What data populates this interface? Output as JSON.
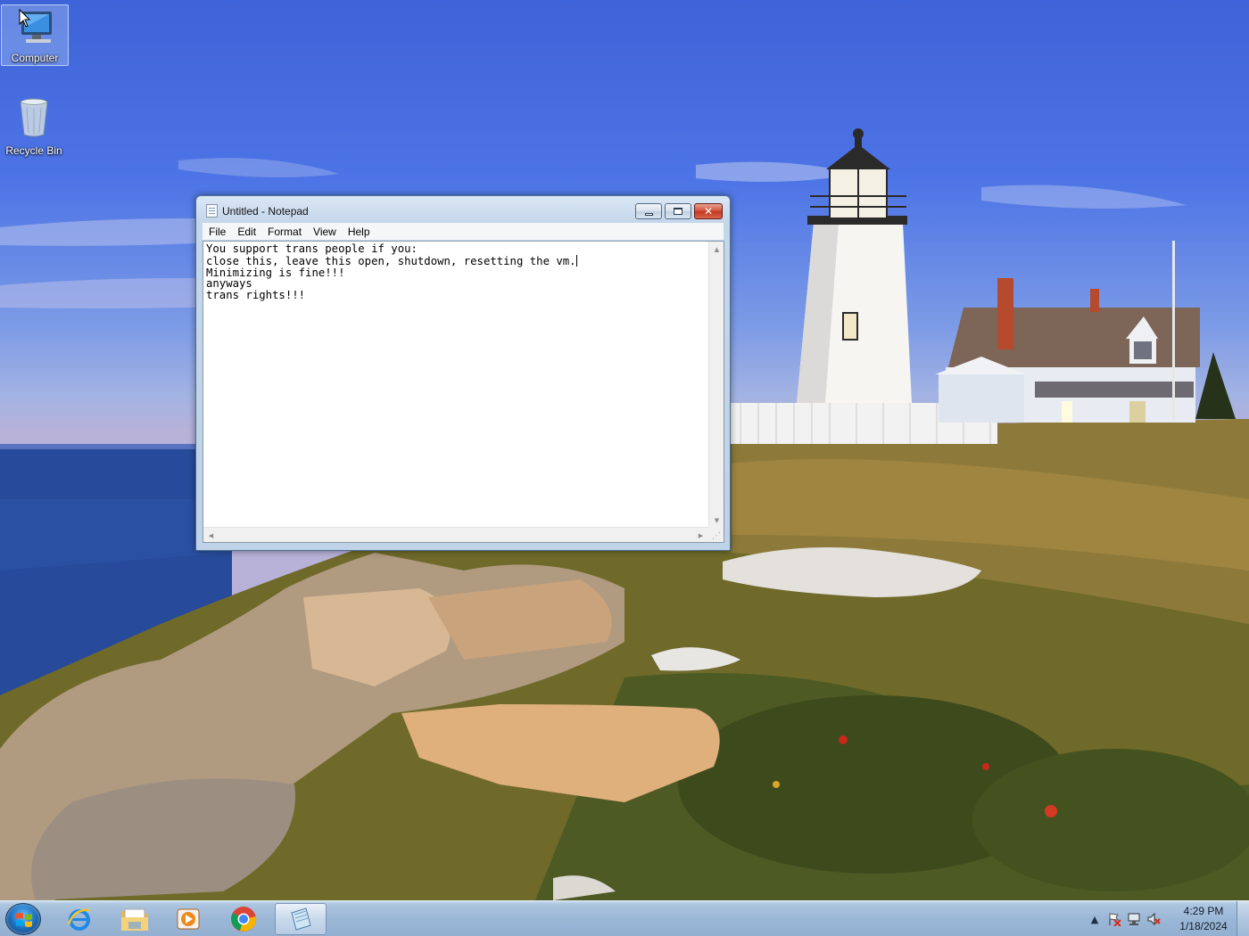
{
  "desktop": {
    "icons": [
      {
        "label": "Computer",
        "icon": "computer-icon",
        "selected": true
      },
      {
        "label": "Recycle Bin",
        "icon": "recycle-bin-icon",
        "selected": false
      }
    ]
  },
  "notepad": {
    "title": "Untitled - Notepad",
    "menu": [
      "File",
      "Edit",
      "Format",
      "View",
      "Help"
    ],
    "lines": [
      "You support trans people if you:",
      "close this, leave this open, shutdown, resetting the vm.",
      "Minimizing is fine!!!",
      "anyways",
      "trans rights!!!"
    ],
    "controls": {
      "minimize": "minimize-icon",
      "maximize": "maximize-icon",
      "close": "close-icon"
    }
  },
  "taskbar": {
    "start": "windows-logo-icon",
    "pinned": [
      {
        "name": "internet-explorer",
        "icon": "internet-explorer-icon"
      },
      {
        "name": "windows-explorer",
        "icon": "folder-icon"
      },
      {
        "name": "media-player",
        "icon": "media-player-icon"
      },
      {
        "name": "chrome",
        "icon": "chrome-icon"
      },
      {
        "name": "notepad",
        "icon": "notepad-icon",
        "active": true
      }
    ],
    "tray": [
      "show-hidden-icons-icon",
      "action-center-flag-icon",
      "network-icon",
      "volume-muted-icon"
    ],
    "clock": {
      "time": "4:29 PM",
      "date": "1/18/2024"
    }
  },
  "colors": {
    "taskbar": "#9bb7d6",
    "window_frame": "#c4d6ea",
    "close_button": "#c3381f",
    "sky": "#4d74e6"
  }
}
